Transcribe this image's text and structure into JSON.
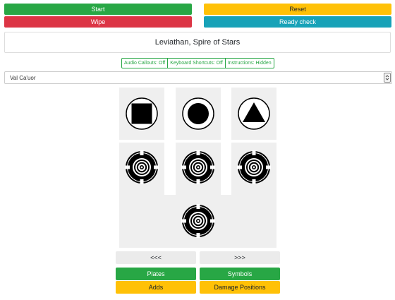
{
  "top_buttons": {
    "start": "Start",
    "reset": "Reset",
    "wipe": "Wipe",
    "ready_check": "Ready check"
  },
  "raid_title": "Leviathan, Spire of Stars",
  "toggles": {
    "audio_callouts": "Audio Callouts: Off",
    "keyboard_shortcuts": "Keyboard Shortcuts: Off",
    "instructions": "Instructions: Hidden"
  },
  "encounter_select": {
    "selected": "Val Ca'uor"
  },
  "symbols": [
    {
      "name": "square",
      "icon": "square-symbol-icon"
    },
    {
      "name": "circle",
      "icon": "circle-symbol-icon"
    },
    {
      "name": "triangle",
      "icon": "triangle-symbol-icon"
    }
  ],
  "plates": [
    {
      "icon": "plate-icon"
    },
    {
      "icon": "plate-icon"
    },
    {
      "icon": "plate-icon"
    },
    {
      "icon": "plate-icon"
    }
  ],
  "nav": {
    "prev": "<<<",
    "next": ">>>"
  },
  "bottom_buttons": {
    "plates": "Plates",
    "symbols": "Symbols",
    "adds": "Adds",
    "damage_positions": "Damage Positions"
  },
  "colors": {
    "green": "#28a745",
    "yellow": "#ffc107",
    "red": "#dc3545",
    "teal": "#17a2b8",
    "panel_grey": "#efefef"
  }
}
